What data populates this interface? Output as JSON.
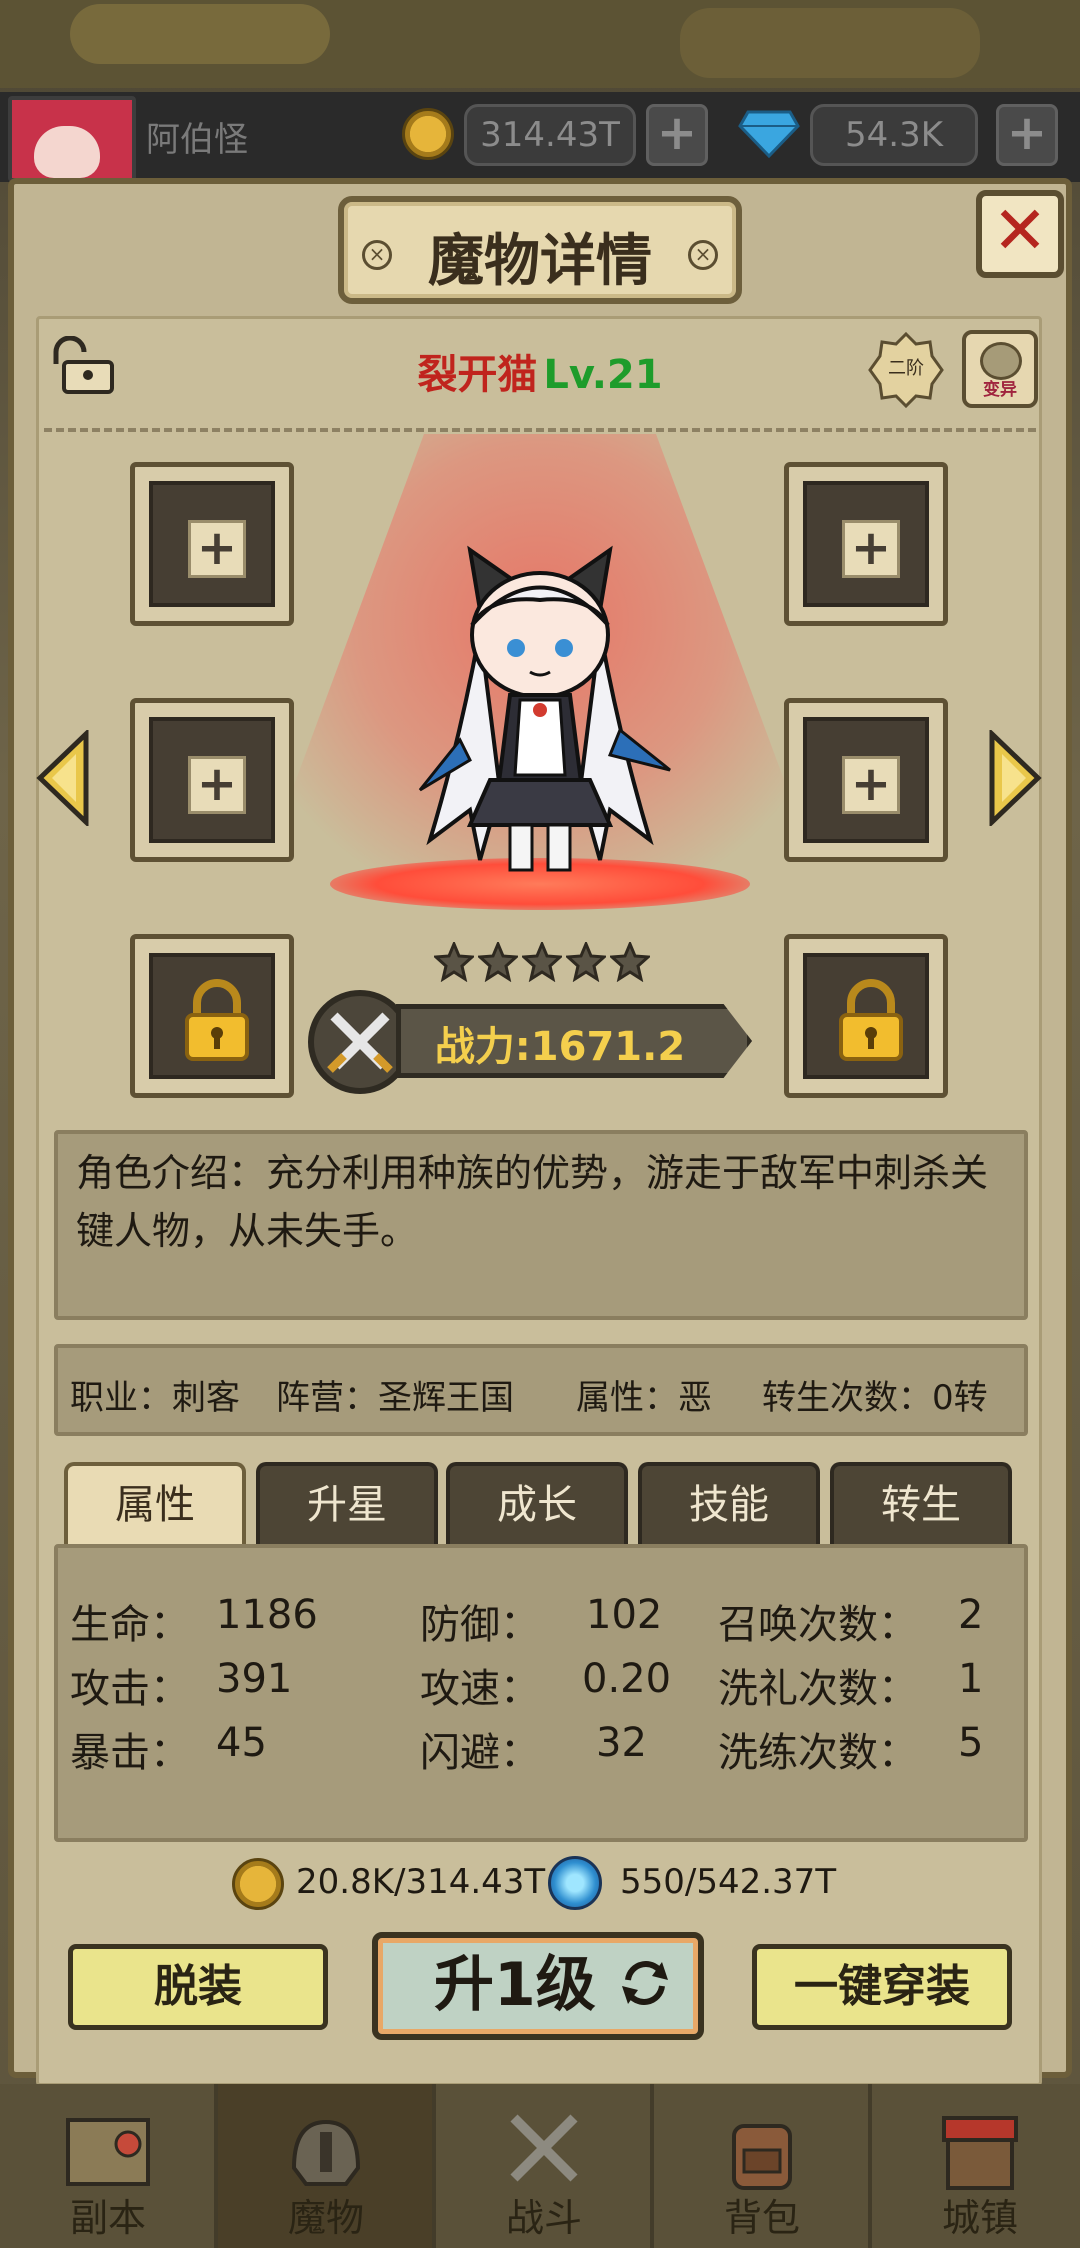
{
  "header": {
    "player_name": "阿伯怪",
    "coins": "314.43T",
    "gems": "54.3K",
    "plus": "+"
  },
  "dialog": {
    "title": "魔物详情",
    "close": "✕",
    "monster_name": "裂开猫",
    "level": "Lv.21",
    "tier": "二阶",
    "mutate_label": "变异",
    "stars": 5,
    "power_label": "战力:1671.2",
    "description": "角色介绍：充分利用种族的优势，游走于敌军中刺杀关键人物，从未失手。",
    "info": {
      "job": "职业：刺客",
      "camp": "阵营：圣辉王国",
      "attribute": "属性：恶",
      "rebirth": "转生次数：0转"
    },
    "slot_plus": "+"
  },
  "tabs": [
    {
      "label": "属性",
      "active": true
    },
    {
      "label": "升星",
      "active": false
    },
    {
      "label": "成长",
      "active": false
    },
    {
      "label": "技能",
      "active": false
    },
    {
      "label": "转生",
      "active": false
    }
  ],
  "stats": {
    "hp_label": "生命：",
    "hp": "1186",
    "def_label": "防御：",
    "def": "102",
    "summon_label": "召唤次数：",
    "summon": "2",
    "atk_label": "攻击：",
    "atk": "391",
    "aspd_label": "攻速：",
    "aspd": "0.20",
    "baptism_label": "洗礼次数：",
    "baptism": "1",
    "crit_label": "暴击：",
    "crit": "45",
    "dodge_label": "闪避：",
    "dodge": "32",
    "refine_label": "洗练次数：",
    "refine": "5"
  },
  "costs": {
    "gold": "20.8K/314.43T",
    "essence": "550/542.37T"
  },
  "buttons": {
    "unequip": "脱装",
    "level_up": "升1级",
    "equip_all": "一键穿装"
  },
  "nav": [
    {
      "label": "副本",
      "icon": "map-icon"
    },
    {
      "label": "魔物",
      "icon": "monster-helmet-icon"
    },
    {
      "label": "战斗",
      "icon": "crossed-swords-icon"
    },
    {
      "label": "背包",
      "icon": "backpack-icon"
    },
    {
      "label": "城镇",
      "icon": "town-icon"
    }
  ],
  "colors": {
    "name_red": "#c0241d",
    "level_green": "#1e9c2b",
    "power_gold": "#f4cf4d",
    "button_yellow": "#eae48c"
  }
}
